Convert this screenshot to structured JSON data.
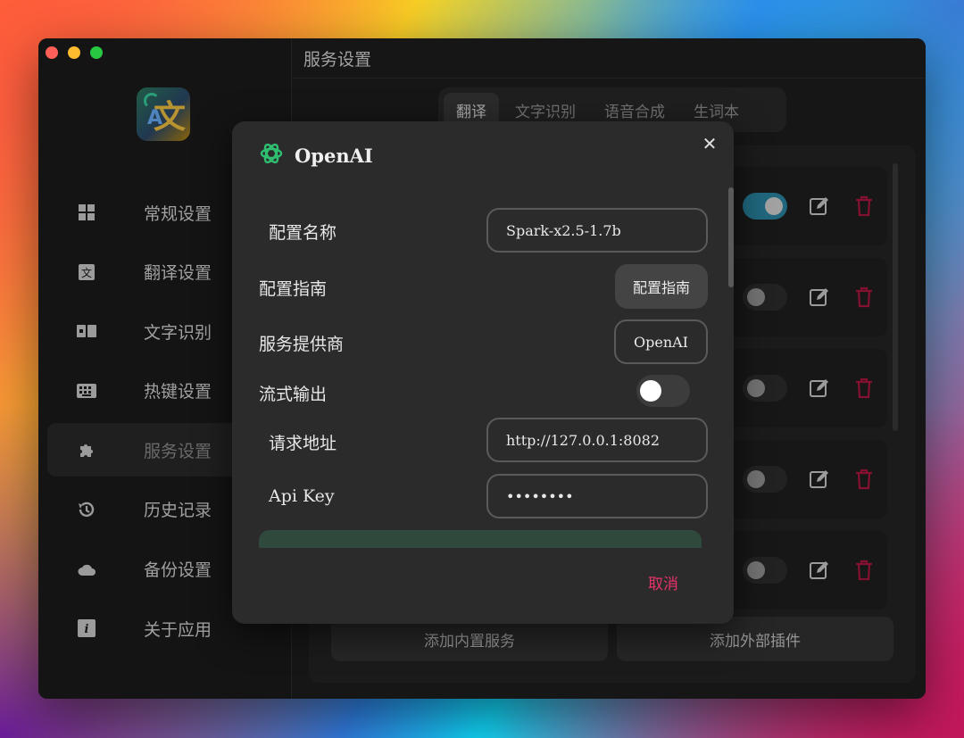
{
  "sidebar": {
    "items": [
      {
        "label": "常规设置",
        "icon": "grid-icon"
      },
      {
        "label": "翻译设置",
        "icon": "translate-icon"
      },
      {
        "label": "文字识别",
        "icon": "ocr-icon"
      },
      {
        "label": "热键设置",
        "icon": "keyboard-icon"
      },
      {
        "label": "服务设置",
        "icon": "puzzle-icon",
        "active": true
      },
      {
        "label": "历史记录",
        "icon": "history-icon"
      },
      {
        "label": "备份设置",
        "icon": "cloud-icon"
      },
      {
        "label": "关于应用",
        "icon": "info-icon"
      }
    ]
  },
  "main": {
    "title": "服务设置",
    "tabs": [
      {
        "label": "翻译",
        "active": true
      },
      {
        "label": "文字识别"
      },
      {
        "label": "语音合成"
      },
      {
        "label": "生词本"
      }
    ],
    "add_builtin": "添加内置服务",
    "add_plugin": "添加外部插件"
  },
  "dialog": {
    "title": "OpenAI",
    "fields": {
      "config_name_label": "配置名称",
      "config_name_value": "Spark-x2.5-1.7b",
      "guide_label": "配置指南",
      "guide_button": "配置指南",
      "provider_label": "服务提供商",
      "provider_value": "OpenAI",
      "stream_label": "流式输出",
      "url_label": "请求地址",
      "url_value": "http://127.0.0.1:8082",
      "apikey_label": "Api Key",
      "apikey_value": "••••••••"
    },
    "cancel": "取消"
  },
  "colors": {
    "accent_toggle": "#2b8aa8",
    "danger": "#e8336a"
  }
}
